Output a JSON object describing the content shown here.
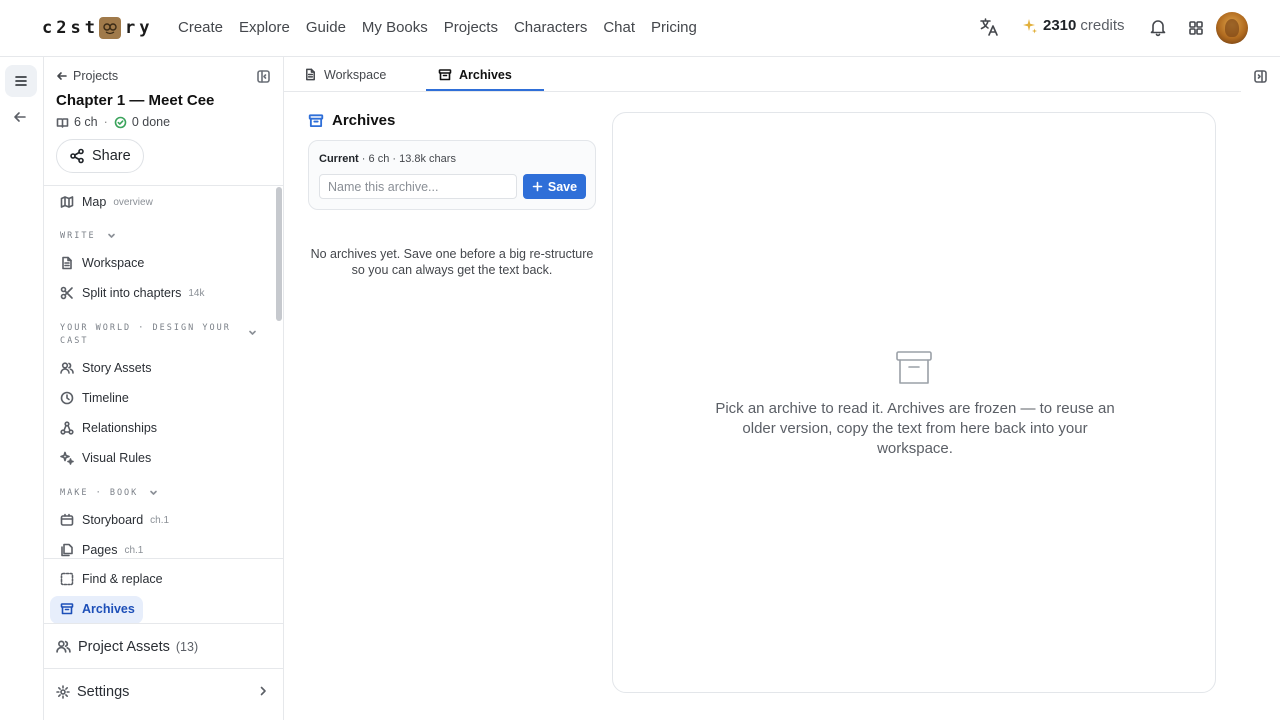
{
  "app": {
    "logo_left": "c2st",
    "logo_right": "ry",
    "nav": [
      "Create",
      "Explore",
      "Guide",
      "My Books",
      "Projects",
      "Characters",
      "Chat",
      "Pricing"
    ],
    "credits_amount": "2310",
    "credits_label": "credits",
    "icons": {
      "translate": "translate-icon",
      "credits": "sparkle-icon",
      "notifications": "bell-icon",
      "apps": "apps-grid-icon"
    }
  },
  "sidebar": {
    "back_label": "Projects",
    "project_title": "Chapter 1 — Meet Cee",
    "chapters": "6 ch",
    "done": "0 done",
    "share_label": "Share",
    "map": {
      "label": "Map",
      "tag": "overview"
    },
    "section_write": "WRITE",
    "workspace": "Workspace",
    "split": {
      "label": "Split into chapters",
      "tag": "14k"
    },
    "section_world": "YOUR WORLD · DESIGN YOUR CAST",
    "story_assets": "Story Assets",
    "timeline": "Timeline",
    "relationships": "Relationships",
    "visual_rules": "Visual Rules",
    "section_make": "MAKE · BOOK",
    "storyboard": {
      "label": "Storyboard",
      "tag": "ch.1"
    },
    "pages": {
      "label": "Pages",
      "tag": "ch.1"
    },
    "find_replace": "Find & replace",
    "archives": "Archives",
    "project_assets": {
      "label": "Project Assets",
      "count": "(13)"
    },
    "settings": "Settings"
  },
  "main": {
    "tabs": [
      {
        "label": "Workspace",
        "icon": "document-icon",
        "active": false
      },
      {
        "label": "Archives",
        "icon": "archive-icon",
        "active": true
      }
    ],
    "heading": "Archives",
    "current_label": "Current",
    "current_meta": "· 6 ch · 13.8k chars",
    "archive_input": {
      "value": "",
      "placeholder": "Name this archive..."
    },
    "save_label": "Save",
    "empty_text": "No archives yet. Save one before a big re-structure so you can always get the text back.",
    "reader_text": "Pick an archive to read it. Archives are frozen — to reuse an older version, copy the text from here back into your workspace."
  },
  "colors": {
    "accent": "#2f6fd8",
    "active_bg": "#e7eefb",
    "done_green": "#3aa35b",
    "credits_gold": "#e2b03c"
  }
}
